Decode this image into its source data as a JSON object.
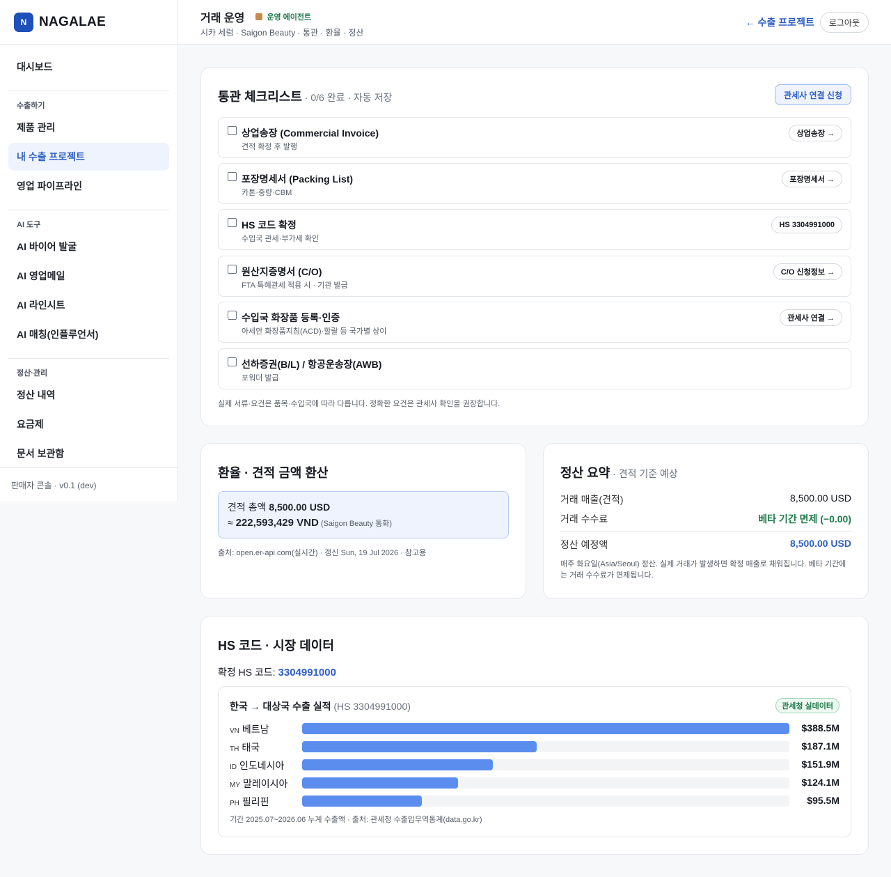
{
  "brand": {
    "logo_letter": "N",
    "name": "NAGALAE"
  },
  "sidebar": {
    "top_item": "대시보드",
    "sections": [
      {
        "title": "수출하기",
        "items": [
          "제품 관리",
          "내 수출 프로젝트",
          "영업 파이프라인"
        ]
      },
      {
        "title": "AI 도구",
        "items": [
          "AI 바이어 발굴",
          "AI 영업메일",
          "AI 라인시트",
          "AI 매칭(인플루언서)"
        ]
      },
      {
        "title": "정산·관리",
        "items": [
          "정산 내역",
          "요금제",
          "문서 보관함"
        ]
      }
    ],
    "active_item": "내 수출 프로젝트",
    "footer": "판매자 콘솔 · v0.1 (dev)"
  },
  "header": {
    "title": "거래 운영",
    "agent_badge": "운영 에이전트",
    "subtitle": "시카 세럼 · Saigon Beauty · 통관 · 환율 · 정산",
    "back_link": "← 수출 프로젝트",
    "logout": "로그아웃"
  },
  "checklist": {
    "title": "통관 체크리스트",
    "progress": " · 0/6 완료 · 자동 저장",
    "broker_button": "관세사 연결 신청",
    "items": [
      {
        "title": "상업송장 (Commercial Invoice)",
        "desc": "견적 확정 후 발행",
        "button": "상업송장 →",
        "checked": false
      },
      {
        "title": "포장명세서 (Packing List)",
        "desc": "카톤·중량·CBM",
        "button": "포장명세서 →",
        "checked": false
      },
      {
        "title": "HS 코드 확정",
        "desc": "수입국 관세·부가세 확인",
        "button": "HS 3304991000",
        "checked": false
      },
      {
        "title": "원산지증명서 (C/O)",
        "desc": "FTA 특혜관세 적용 시 · 기관 발급",
        "button": "C/O 신청정보 →",
        "checked": false
      },
      {
        "title": "수입국 화장품 등록·인증",
        "desc": "아세안 화장품지침(ACD)·할랄 등 국가별 상이",
        "button": "관세사 연결 →",
        "checked": false
      },
      {
        "title": "선하증권(B/L) / 항공운송장(AWB)",
        "desc": "포워더 발급",
        "button": "",
        "checked": false
      }
    ],
    "note": "실제 서류·요건은 품목·수입국에 따라 다릅니다. 정확한 요건은 관세사 확인을 권장합니다."
  },
  "exchange": {
    "title": "환율 · 견적 금액 환산",
    "total_label": "견적 총액 ",
    "total_value": "8,500.00 USD",
    "approx_prefix": "≈ ",
    "converted_value": "222,593,429 VND",
    "converted_note": " (Saigon Beauty 통화)",
    "source": "출처: open.er-api.com(실시간) · 갱신 Sun, 19 Jul 2026 · 참고용"
  },
  "settlement": {
    "title": "정산 요약",
    "subtitle": " · 견적 기준 예상",
    "rows": [
      {
        "label": "거래 매출(견적)",
        "value": "8,500.00 USD"
      },
      {
        "label": "거래 수수료",
        "value": "베타 기간 면제 (−0.00)"
      }
    ],
    "total_label": "정산 예정액",
    "total_value": "8,500.00 USD",
    "note": "매주 화요일(Asia/Seoul) 정산. 실제 거래가 발생하면 확정 매출로 채워집니다. 베타 기간에는 거래 수수료가 면제됩니다."
  },
  "market": {
    "title": "HS 코드 · 시장 데이터",
    "hs_label": "확정 HS 코드: ",
    "hs_code": "3304991000",
    "box_title": "한국 → 대상국 수출 실적",
    "box_title_code": " (HS 3304991000)",
    "badge": "관세청 실데이터",
    "footnote": "기간 2025.07~2026.06 누계 수출액 · 출처: 관세청 수출입무역통계(data.go.kr)"
  },
  "chart_data": {
    "type": "bar",
    "orientation": "horizontal",
    "categories": [
      "VN 베트남",
      "TH 태국",
      "ID 인도네시아",
      "MY 말레이시아",
      "PH 필리핀"
    ],
    "country_codes": [
      "VN",
      "TH",
      "ID",
      "MY",
      "PH"
    ],
    "country_names": [
      "베트남",
      "태국",
      "인도네시아",
      "말레이시아",
      "필리핀"
    ],
    "values": [
      388.5,
      187.1,
      151.9,
      124.1,
      95.5
    ],
    "value_labels": [
      "$388.5M",
      "$187.1M",
      "$151.9M",
      "$124.1M",
      "$95.5M"
    ],
    "unit": "USD million",
    "bar_color": "#5b8def",
    "xlim": [
      0,
      388.5
    ]
  },
  "colors": {
    "accent": "#2f5fc4",
    "success": "#1f7a4a",
    "bar": "#5b8def"
  }
}
